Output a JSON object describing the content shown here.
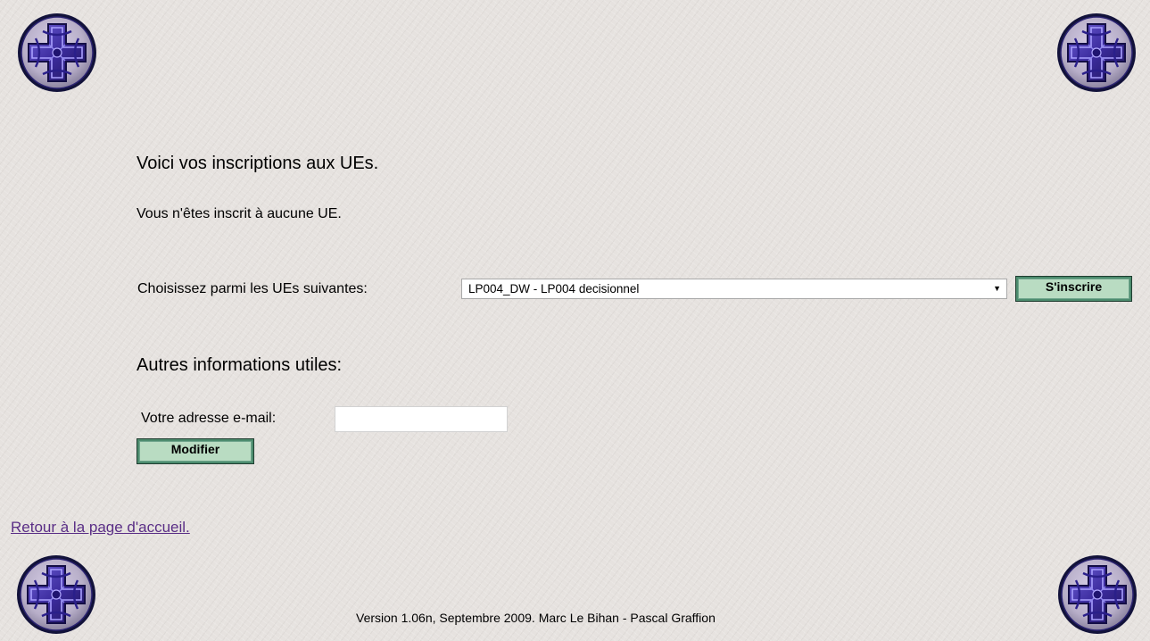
{
  "page": {
    "title": "Voici vos inscriptions aux UEs.",
    "no_subscription_text": "Vous n'êtes inscrit à aucune UE."
  },
  "subscribe_form": {
    "label": "Choisissez parmi les UEs suivantes:",
    "selected_ue": "LP004_DW - LP004 decisionnel",
    "button_label": "S'inscrire"
  },
  "other_info": {
    "heading": "Autres informations utiles:",
    "email_label": "Votre adresse e-mail:",
    "email_value": "",
    "button_label": "Modifier"
  },
  "home_link": "Retour à la page d'accueil.",
  "footer": "Version 1.06n, Septembre 2009. Marc Le Bihan - Pascal Graffion",
  "colors": {
    "background": "#e6e2df",
    "link": "#5a2e86",
    "button_face": "#b9dcc2",
    "button_border": "#4c8c6e",
    "logo_cross": "#3c2c9e"
  },
  "icons": {
    "corner_logo": "celtic-cross-medallion-icon"
  }
}
